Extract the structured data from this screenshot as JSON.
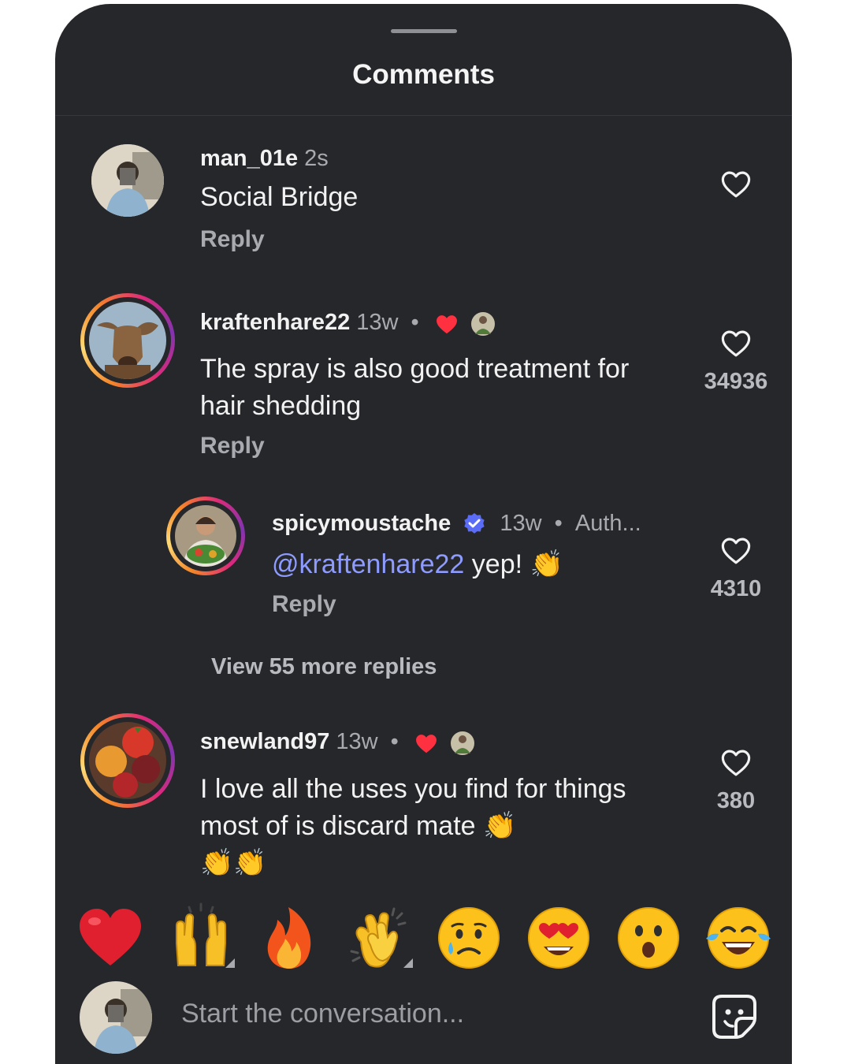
{
  "sheet": {
    "title": "Comments"
  },
  "comments": [
    {
      "username": "man_01e",
      "time": "2s",
      "text": "Social Bridge",
      "reply": "Reply"
    },
    {
      "username": "kraftenhare22",
      "time": "13w",
      "text": "The spray is also good treatment for hair shedding",
      "reply": "Reply",
      "likes": "34936"
    },
    {
      "username": "spicymoustache",
      "time": "13w",
      "tag": "Auth...",
      "mention": "@kraftenhare22",
      "text": "yep! 👏",
      "reply": "Reply",
      "likes": "4310"
    },
    {
      "username": "snewland97",
      "time": "13w",
      "text": "I love all the uses you find for things most of is discard mate 👏",
      "text2": "👏👏",
      "likes": "380"
    }
  ],
  "view_more": "View 55 more replies",
  "separator": "•",
  "quick_reactions": [
    "heart",
    "raised-hands",
    "fire",
    "clapping-hands",
    "crying-face",
    "heart-eyes-face",
    "surprised-face",
    "tears-of-joy-face"
  ],
  "composer": {
    "placeholder": "Start the conversation..."
  },
  "colors": {
    "background": "#26272b",
    "text": "#f2f2f2",
    "muted": "#a8aab0",
    "mention": "#8e9bff",
    "verified": "#5b6cf6",
    "liked": "#ff3040"
  }
}
